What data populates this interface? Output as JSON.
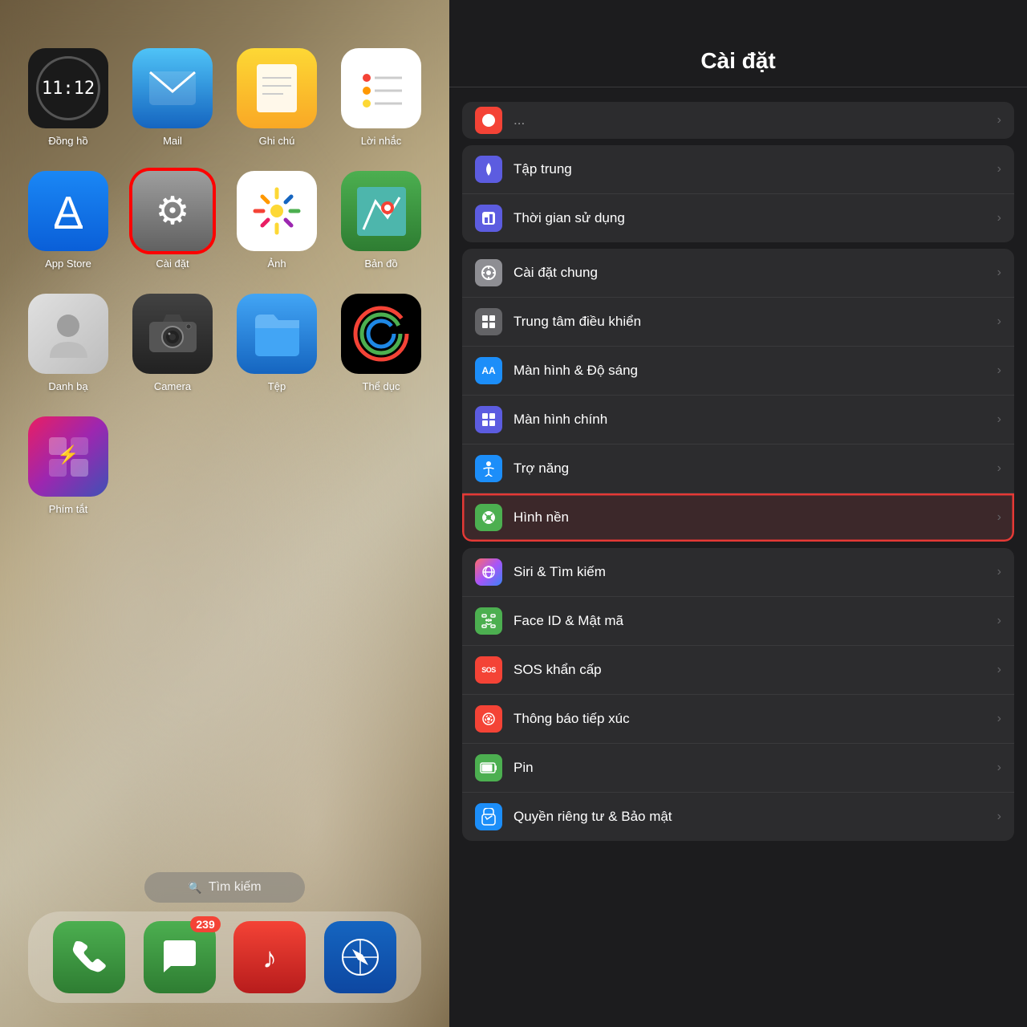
{
  "leftPanel": {
    "apps": [
      {
        "id": "clock",
        "label": "Đồng hồ",
        "iconType": "clock"
      },
      {
        "id": "mail",
        "label": "Mail",
        "iconType": "mail"
      },
      {
        "id": "notes",
        "label": "Ghi chú",
        "iconType": "notes"
      },
      {
        "id": "reminders",
        "label": "Lời nhắc",
        "iconType": "reminders"
      },
      {
        "id": "appstore",
        "label": "App Store",
        "iconType": "appstore"
      },
      {
        "id": "settings",
        "label": "Cài đặt",
        "iconType": "settings",
        "selected": true
      },
      {
        "id": "photos",
        "label": "Ảnh",
        "iconType": "photos"
      },
      {
        "id": "maps",
        "label": "Bản đồ",
        "iconType": "maps"
      },
      {
        "id": "contacts",
        "label": "Danh bạ",
        "iconType": "contacts"
      },
      {
        "id": "camera",
        "label": "Camera",
        "iconType": "camera"
      },
      {
        "id": "files",
        "label": "Tệp",
        "iconType": "files"
      },
      {
        "id": "fitness",
        "label": "Thể dục",
        "iconType": "fitness"
      },
      {
        "id": "shortcuts",
        "label": "Phím tắt",
        "iconType": "shortcuts"
      }
    ],
    "searchBar": {
      "placeholder": "Tìm kiếm"
    },
    "dock": [
      {
        "id": "phone",
        "iconType": "phone",
        "badge": null
      },
      {
        "id": "messages",
        "iconType": "messages",
        "badge": "239"
      },
      {
        "id": "music",
        "iconType": "music",
        "badge": null
      },
      {
        "id": "safari",
        "iconType": "safari",
        "badge": null
      }
    ]
  },
  "rightPanel": {
    "title": "Cài đặt",
    "sections": [
      {
        "id": "partial-top",
        "items": [
          {
            "id": "partial",
            "iconColor": "#f44336",
            "iconEmoji": "🔴",
            "label": "",
            "partial": true
          }
        ]
      },
      {
        "id": "focus-screentime",
        "items": [
          {
            "id": "focus",
            "iconColor": "#5c5ce0",
            "iconEmoji": "🌙",
            "label": "Tập trung"
          },
          {
            "id": "screentime",
            "iconColor": "#5c5ce0",
            "iconEmoji": "⏱",
            "label": "Thời gian sử dụng"
          }
        ]
      },
      {
        "id": "display-group",
        "items": [
          {
            "id": "general",
            "iconColor": "#8e8e93",
            "iconEmoji": "⚙️",
            "label": "Cài đặt chung"
          },
          {
            "id": "control",
            "iconColor": "#636366",
            "iconEmoji": "⊡",
            "label": "Trung tâm điều khiển"
          },
          {
            "id": "display",
            "iconColor": "#1c8ef9",
            "iconEmoji": "AA",
            "label": "Màn hình & Độ sáng"
          },
          {
            "id": "homescreen",
            "iconColor": "#5c5ce0",
            "iconEmoji": "⠿",
            "label": "Màn hình chính"
          },
          {
            "id": "accessibility",
            "iconColor": "#1c8ef9",
            "iconEmoji": "♿",
            "label": "Trợ năng"
          },
          {
            "id": "wallpaper",
            "iconColor": "#4caf50",
            "iconEmoji": "❊",
            "label": "Hình nền",
            "highlighted": true
          }
        ]
      },
      {
        "id": "siri-group",
        "items": [
          {
            "id": "siri",
            "iconColor": "gradient",
            "iconEmoji": "◎",
            "label": "Siri & Tìm kiếm"
          },
          {
            "id": "faceid",
            "iconColor": "#4caf50",
            "iconEmoji": "😊",
            "label": "Face ID & Mật mã"
          },
          {
            "id": "sos",
            "iconColor": "#f44336",
            "iconEmoji": "SOS",
            "label": "SOS khẩn cấp"
          },
          {
            "id": "exposure",
            "iconColor": "#f44336",
            "iconEmoji": "◉",
            "label": "Thông báo tiếp xúc"
          },
          {
            "id": "battery",
            "iconColor": "#4caf50",
            "iconEmoji": "🔋",
            "label": "Pin"
          },
          {
            "id": "privacy",
            "iconColor": "#1c8ef9",
            "iconEmoji": "✋",
            "label": "Quyền riêng tư & Bảo mật"
          }
        ]
      }
    ]
  }
}
